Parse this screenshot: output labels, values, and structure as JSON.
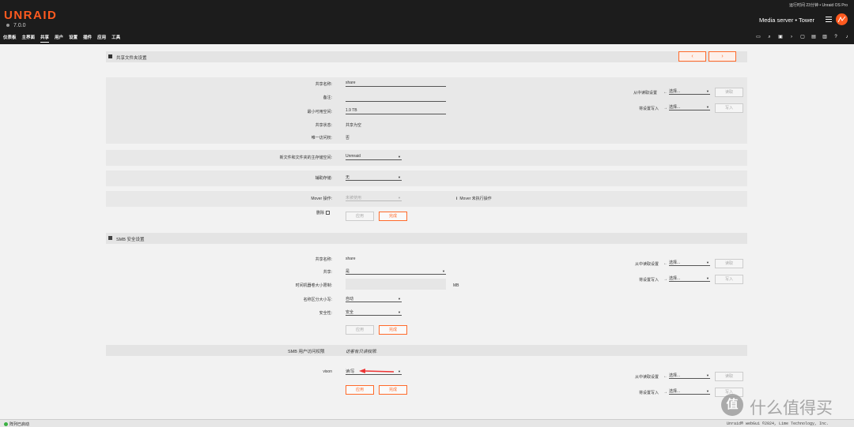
{
  "header": {
    "logo": "UNRAID",
    "version": "7.0.0",
    "uptime": "运行时间 23分钟 • Unraid OS Pro",
    "server": "Media server • Tower",
    "nav": [
      "仪表板",
      "主界面",
      "共享",
      "用户",
      "设置",
      "插件",
      "应用",
      "工具"
    ],
    "active_nav": "共享",
    "accent": "#ff5a1f"
  },
  "share_settings": {
    "title": "共享文件夹设置",
    "prev_btn": "‹",
    "next_btn": "›",
    "name_label": "共享名称:",
    "name_value": "share",
    "comment_label": "备注:",
    "comment_value": "",
    "min_free_label": "最小可用空间:",
    "min_free_value": "1.9 TB",
    "status_label": "共享状态:",
    "status_value": "共享为空",
    "exclusive_label": "唯一访问权:",
    "exclusive_value": "否",
    "primary_label": "新文件和文件夹的主存储空间:",
    "primary_value": "Unmraid",
    "secondary_label": "辅助存储:",
    "secondary_value": "无",
    "mover_label": "Mover 操作:",
    "mover_value": "未被使用",
    "mover_info": "Mover 未执行操作",
    "delete_label": "删除",
    "apply_btn": "应用",
    "done_btn": "完成",
    "read_from_label": "从中读取设置",
    "write_to_label": "将设置写入",
    "select_placeholder": "选择...",
    "read_btn": "读取",
    "write_btn": "写入"
  },
  "smb_settings": {
    "title": "SMB 安全设置",
    "name_label": "共享名称:",
    "name_value": "share",
    "export_label": "共享:",
    "export_value": "是",
    "tm_label": "时间机器卷大小限制:",
    "tm_unit": "MB",
    "case_label": "名称区分大小写:",
    "case_value": "自动",
    "security_label": "安全性:",
    "security_value": "安全",
    "apply_btn": "应用",
    "done_btn": "完成",
    "read_from_label": "从中读取设置",
    "write_to_label": "将设置写入",
    "select_placeholder": "选择...",
    "read_btn": "读取",
    "write_btn": "写入"
  },
  "smb_users": {
    "title": "SMB 用户访问权限",
    "guest_note": "访客有只读权限.",
    "user_label": "vison",
    "user_value": "读/写",
    "apply_btn": "应用",
    "done_btn": "完成",
    "read_from_label": "从中读取设置",
    "write_to_label": "将设置写入",
    "select_placeholder": "选择...",
    "read_btn": "读取",
    "write_btn": "写入"
  },
  "footer": {
    "status": "阵列已启动",
    "copyright": "Unraid® webGui ©2024, Lime Technology, Inc."
  },
  "watermark": {
    "badge": "值",
    "text": "什么值得买"
  }
}
